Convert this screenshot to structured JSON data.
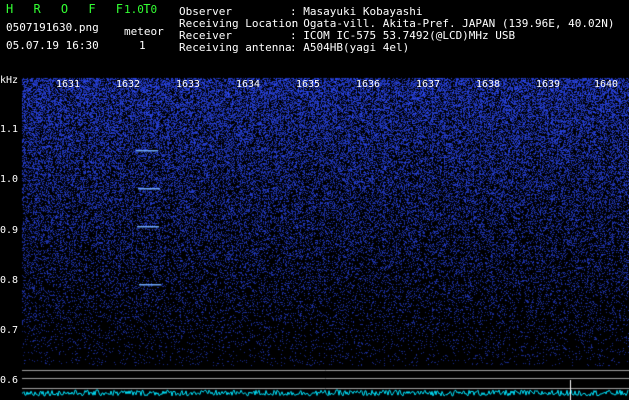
{
  "header": {
    "app_title": "H R O F F T",
    "version": "1.0.0",
    "filename": "0507191630.png",
    "timestamp": "05.07.19 16:30",
    "mode_label": "meteor",
    "mode_value": "1"
  },
  "station": {
    "observer_label": "Observer",
    "observer_value": ": Masayuki Kobayashi",
    "location_label": "Receiving Location",
    "location_value": ": Ogata-vill. Akita-Pref. JAPAN (139.96E, 40.02N)",
    "receiver_label": "Receiver",
    "receiver_value": ": ICOM IC-575 53.7492(@LCD)MHz USB",
    "antenna_label": "Receiving antenna",
    "antenna_value": ": A504HB(yagi 4el)"
  },
  "chart_data": {
    "type": "heatmap",
    "ylabel": "kHz",
    "y_ticks": [
      "1.1",
      "1.0",
      "0.9",
      "0.8",
      "0.7",
      "0.6"
    ],
    "x_ticks": [
      "1631",
      "1632",
      "1633",
      "1634",
      "1635",
      "1636",
      "1637",
      "1638",
      "1639",
      "1640"
    ],
    "colors": {
      "signal": "#2b4dff",
      "background": "#000000",
      "trace": "#00e5ff",
      "grid": "#a0a0a0"
    }
  }
}
